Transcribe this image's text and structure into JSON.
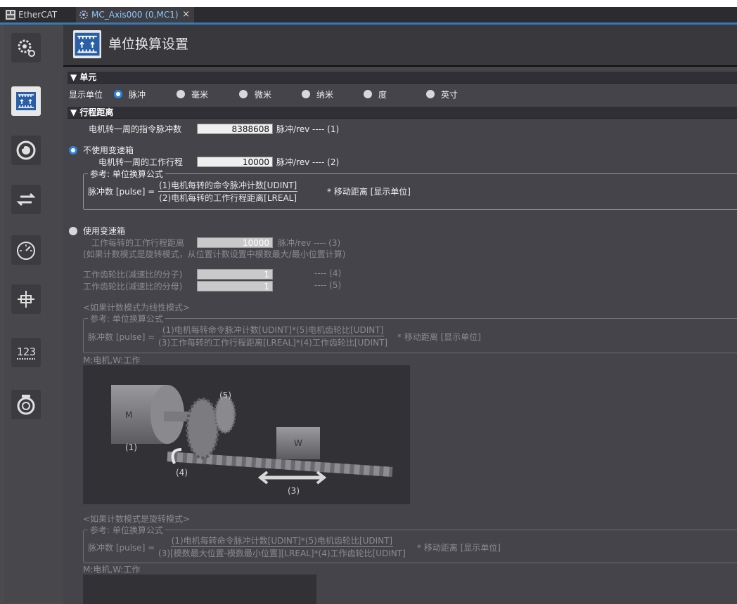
{
  "tabs": [
    {
      "label": "EtherCAT",
      "icon": "ethercat-icon"
    },
    {
      "label": "MC_Axis000 (0,MC1)",
      "icon": "axis-gear-icon",
      "close": "×"
    }
  ],
  "sidebar": {
    "buttons": [
      {
        "icon": "gear-settings-icon"
      },
      {
        "icon": "unit-conversion-icon"
      },
      {
        "icon": "operation-mode-icon"
      },
      {
        "icon": "direction-arrows-icon"
      },
      {
        "icon": "speedometer-icon"
      },
      {
        "icon": "position-limit-icon"
      },
      {
        "icon": "numeric-display-icon"
      },
      {
        "icon": "servo-motor-icon"
      }
    ]
  },
  "page": {
    "title": "单位换算设置"
  },
  "unit_section": {
    "header": "▼ 单元",
    "display_unit_label": "显示单位",
    "options": [
      "脉冲",
      "毫米",
      "微米",
      "纳米",
      "度",
      "英寸"
    ],
    "selected": "脉冲"
  },
  "travel_section": {
    "header": "▼ 行程距离",
    "pulses_label": "电机转一周的指令脉冲数",
    "pulses_value": "8388608",
    "pulses_unit": "脉冲/rev ---- (1)",
    "no_gear": {
      "label": "不使用变速箱",
      "selected": true,
      "travel_label": "电机转一周的工作行程",
      "travel_value": "10000",
      "travel_unit": "脉冲/rev ---- (2)",
      "formula_title": "参考: 单位换算公式",
      "formula_lhs": "脉冲数 [pulse] =",
      "formula_num": "(1)电机每转的命令脉冲计数[UDINT]",
      "formula_den": "(2)电机每转的工作行程距离[LREAL]",
      "formula_rhs": "* 移动距离 [显示单位]"
    },
    "use_gear": {
      "label": "使用变速箱",
      "selected": false,
      "travel_label": "工作每转的工作行程距离",
      "travel_value": "10000",
      "travel_unit": "脉冲/rev ---- (3)",
      "note": "(如果计数模式是旋转模式，从位置计数设置中模数最大/最小位置计算)",
      "num_label": "工作齿轮比(减速比的分子)",
      "num_value": "1",
      "num_ref": "---- (4)",
      "den_label": "工作齿轮比(减速比的分母)",
      "den_value": "1",
      "den_ref": "---- (5)",
      "linear_title": "<如果计数模式为线性模式>",
      "linear_formula_title": "参考: 单位换算公式",
      "linear_lhs": "脉冲数 [pulse] =",
      "linear_num": "(1)电机每转命令脉冲计数[UDINT]*(5)电机齿轮比[UDINT]",
      "linear_den": "(3)工作每转的工作行程距离[LREAL]*(4)工作齿轮比[UDINT]",
      "linear_rhs": "* 移动距离 [显示单位]",
      "caption": "M:电机,W:工作",
      "figure_labels": {
        "motor": "M",
        "work": "W",
        "p1": "(1)",
        "p3": "(3)",
        "p4": "(4)",
        "p5": "(5)"
      },
      "rotary_title": "<如果计数模式是旋转模式>",
      "rotary_formula_title": "参考: 单位换算公式",
      "rotary_lhs": "脉冲数 [pulse] =",
      "rotary_num": "(1)电机每转命令脉冲计数[UDINT]*(5)电机齿轮比[UDINT]",
      "rotary_den": "(3)[模数最大位置-模数最小位置][LREAL]*(4)工作齿轮比[UDINT]",
      "rotary_rhs": "* 移动距离 [显示单位]",
      "caption2": "M:电机,W:工作"
    }
  },
  "colors": {
    "accent": "#2e86de",
    "tab_active_text": "#8cc8ff",
    "background": "#44444a"
  }
}
